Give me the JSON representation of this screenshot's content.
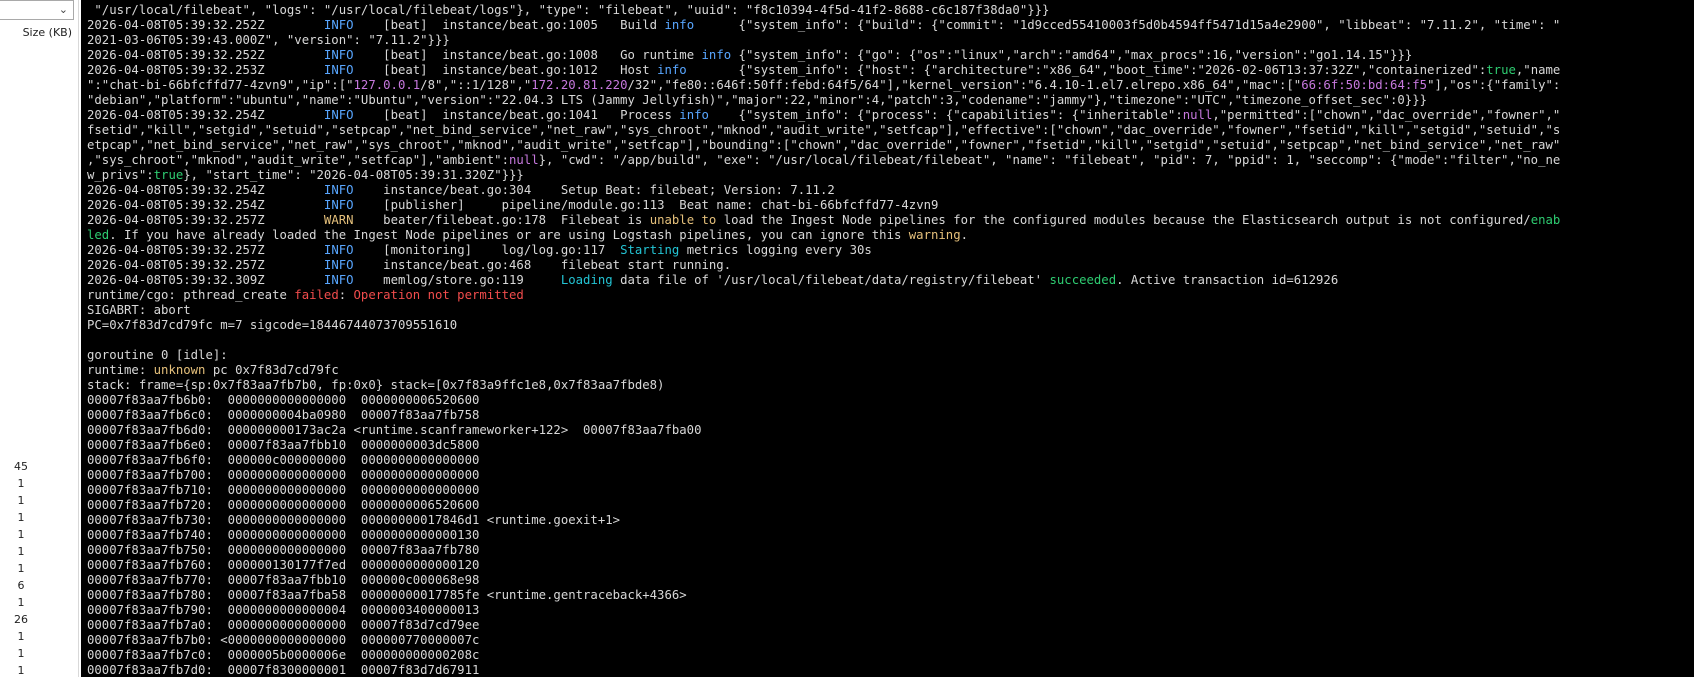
{
  "left_panel": {
    "dropdown_value": "",
    "column_header": "Size (KB)",
    "sizes": [
      "45",
      "1",
      "1",
      "1",
      "1",
      "1",
      "1",
      "6",
      "1",
      "26",
      "1",
      "1",
      "1"
    ]
  },
  "colors": {
    "info": "#58a6ff",
    "warn": "#e5c07b",
    "error": "#f14c4c",
    "null": "#c678dd",
    "success": "#2ecc71",
    "starting": "#23c4d4"
  },
  "log_lines": [
    [
      {
        "t": " \"/usr/local/filebeat\", \"logs\": \"/usr/local/filebeat/logs\"}, \"type\": \"filebeat\", \"uuid\": \"f8c10394-4f5d-41f2-8688-c6c187f38da0\"}}}"
      }
    ],
    [
      {
        "t": "2026-04-08T05:39:32.252Z        "
      },
      {
        "t": "INFO",
        "c": "i"
      },
      {
        "t": "    [beat]  instance/beat.go:1005   Build "
      },
      {
        "t": "info",
        "c": "i"
      },
      {
        "t": "      {\"system_info\": {\"build\": {\"commit\": \"1d9cced55410003f5d0b4594ff5471d15a4e2900\", \"libbeat\": \"7.11.2\", \"time\": \""
      }
    ],
    [
      {
        "t": "2021-03-06T05:39:43.000Z\", \"version\": \"7.11.2\"}}}"
      }
    ],
    [
      {
        "t": "2026-04-08T05:39:32.252Z        "
      },
      {
        "t": "INFO",
        "c": "i"
      },
      {
        "t": "    [beat]  instance/beat.go:1008   Go runtime "
      },
      {
        "t": "info",
        "c": "i"
      },
      {
        "t": " {\"system_info\": {\"go\": {\"os\":\"linux\",\"arch\":\"amd64\",\"max_procs\":16,\"version\":\"go1.14.15\"}}}"
      }
    ],
    [
      {
        "t": "2026-04-08T05:39:32.253Z        "
      },
      {
        "t": "INFO",
        "c": "i"
      },
      {
        "t": "    [beat]  instance/beat.go:1012   Host "
      },
      {
        "t": "info",
        "c": "i"
      },
      {
        "t": "       {\"system_info\": {\"host\": {\"architecture\":\"x86_64\",\"boot_time\":\"2026-02-06T13:37:32Z\",\"containerized\":"
      },
      {
        "t": "true",
        "c": "g"
      },
      {
        "t": ",\"name"
      }
    ],
    [
      {
        "t": "\":\"chat-bi-66bfcffd77-4zvn9\",\"ip\":[\""
      },
      {
        "t": "127.0.0.1",
        "c": "m"
      },
      {
        "t": "/8\",\"::1/128\",\""
      },
      {
        "t": "172.20.81.220",
        "c": "m"
      },
      {
        "t": "/32\",\"fe80::646f:50ff:febd:64f5/64\"],\"kernel_version\":\"6.4.10-1.el7.elrepo.x86_64\",\"mac\":[\""
      },
      {
        "t": "66:6f:50:bd:64:f5",
        "c": "m"
      },
      {
        "t": "\"],\"os\":{\"family\":"
      }
    ],
    [
      {
        "t": "\"debian\",\"platform\":\"ubuntu\",\"name\":\"Ubuntu\",\"version\":\"22.04.3 LTS (Jammy Jellyfish)\",\"major\":22,\"minor\":4,\"patch\":3,\"codename\":\"jammy\"},\"timezone\":\"UTC\",\"timezone_offset_sec\":0}}}"
      }
    ],
    [
      {
        "t": "2026-04-08T05:39:32.254Z        "
      },
      {
        "t": "INFO",
        "c": "i"
      },
      {
        "t": "    [beat]  instance/beat.go:1041   Process "
      },
      {
        "t": "info",
        "c": "i"
      },
      {
        "t": "    {\"system_info\": {\"process\": {\"capabilities\": {\"inheritable\":"
      },
      {
        "t": "null",
        "c": "m"
      },
      {
        "t": ",\"permitted\":[\"chown\",\"dac_override\",\"fowner\",\""
      }
    ],
    [
      {
        "t": "fsetid\",\"kill\",\"setgid\",\"setuid\",\"setpcap\",\"net_bind_service\",\"net_raw\",\"sys_chroot\",\"mknod\",\"audit_write\",\"setfcap\"],\"effective\":[\"chown\",\"dac_override\",\"fowner\",\"fsetid\",\"kill\",\"setgid\",\"setuid\",\"s"
      }
    ],
    [
      {
        "t": "etpcap\",\"net_bind_service\",\"net_raw\",\"sys_chroot\",\"mknod\",\"audit_write\",\"setfcap\"],\"bounding\":[\"chown\",\"dac_override\",\"fowner\",\"fsetid\",\"kill\",\"setgid\",\"setuid\",\"setpcap\",\"net_bind_service\",\"net_raw\""
      }
    ],
    [
      {
        "t": ",\"sys_chroot\",\"mknod\",\"audit_write\",\"setfcap\"],\"ambient\":"
      },
      {
        "t": "null",
        "c": "m"
      },
      {
        "t": "}, \"cwd\": \"/app/build\", \"exe\": \"/usr/local/filebeat/filebeat\", \"name\": \"filebeat\", \"pid\": 7, \"ppid\": 1, \"seccomp\": {\"mode\":\"filter\",\"no_ne"
      }
    ],
    [
      {
        "t": "w_privs\":"
      },
      {
        "t": "true",
        "c": "g"
      },
      {
        "t": "}, \"start_time\": \"2026-04-08T05:39:31.320Z\"}}}"
      }
    ],
    [
      {
        "t": "2026-04-08T05:39:32.254Z        "
      },
      {
        "t": "INFO",
        "c": "i"
      },
      {
        "t": "    instance/beat.go:304    Setup Beat: filebeat; Version: 7.11.2"
      }
    ],
    [
      {
        "t": "2026-04-08T05:39:32.254Z        "
      },
      {
        "t": "INFO",
        "c": "i"
      },
      {
        "t": "    [publisher]     pipeline/module.go:113  Beat name: chat-bi-66bfcffd77-4zvn9"
      }
    ],
    [
      {
        "t": "2026-04-08T05:39:32.257Z        "
      },
      {
        "t": "WARN",
        "c": "y"
      },
      {
        "t": "    beater/filebeat.go:178  Filebeat is "
      },
      {
        "t": "unable to",
        "c": "y"
      },
      {
        "t": " load the Ingest Node pipelines for the configured modules because the Elasticsearch output is not configured/"
      },
      {
        "t": "enab",
        "c": "g"
      }
    ],
    [
      {
        "t": "led",
        "c": "g"
      },
      {
        "t": ". If you have already loaded the Ingest Node pipelines or are using Logstash pipelines, you can ignore this "
      },
      {
        "t": "warning",
        "c": "y"
      },
      {
        "t": "."
      }
    ],
    [
      {
        "t": "2026-04-08T05:39:32.257Z        "
      },
      {
        "t": "INFO",
        "c": "i"
      },
      {
        "t": "    [monitoring]    log/log.go:117  "
      },
      {
        "t": "Starting",
        "c": "c"
      },
      {
        "t": " metrics logging every 30s"
      }
    ],
    [
      {
        "t": "2026-04-08T05:39:32.257Z        "
      },
      {
        "t": "INFO",
        "c": "i"
      },
      {
        "t": "    instance/beat.go:468    filebeat start running."
      }
    ],
    [
      {
        "t": "2026-04-08T05:39:32.309Z        "
      },
      {
        "t": "INFO",
        "c": "i"
      },
      {
        "t": "    memlog/store.go:119     "
      },
      {
        "t": "Loading",
        "c": "c"
      },
      {
        "t": " data file of '/usr/local/filebeat/data/registry/filebeat' "
      },
      {
        "t": "succeeded",
        "c": "g"
      },
      {
        "t": ". Active transaction id=612926"
      }
    ],
    [
      {
        "t": "runtime/cgo: pthread_create "
      },
      {
        "t": "failed",
        "c": "r"
      },
      {
        "t": ": "
      },
      {
        "t": "Operation not permitted",
        "c": "r"
      }
    ],
    [
      {
        "t": "SIGABRT: abort"
      }
    ],
    [
      {
        "t": "PC=0x7f83d7cd79fc m=7 sigcode=18446744073709551610"
      }
    ],
    [],
    [
      {
        "t": "goroutine 0 [idle]:"
      }
    ],
    [
      {
        "t": "runtime: "
      },
      {
        "t": "unknown",
        "c": "y"
      },
      {
        "t": " pc 0x7f83d7cd79fc"
      }
    ],
    [
      {
        "t": "stack: frame={sp:0x7f83aa7fb7b0, fp:0x0} stack=[0x7f83a9ffc1e8,0x7f83aa7fbde8)"
      }
    ],
    [
      {
        "t": "00007f83aa7fb6b0:  0000000000000000  0000000006520600"
      }
    ],
    [
      {
        "t": "00007f83aa7fb6c0:  0000000004ba0980  00007f83aa7fb758"
      }
    ],
    [
      {
        "t": "00007f83aa7fb6d0:  000000000173ac2a <runtime.scanframeworker+122>  00007f83aa7fba00"
      }
    ],
    [
      {
        "t": "00007f83aa7fb6e0:  00007f83aa7fbb10  0000000003dc5800"
      }
    ],
    [
      {
        "t": "00007f83aa7fb6f0:  000000c000000000  0000000000000000"
      }
    ],
    [
      {
        "t": "00007f83aa7fb700:  0000000000000000  0000000000000000"
      }
    ],
    [
      {
        "t": "00007f83aa7fb710:  0000000000000000  0000000000000000"
      }
    ],
    [
      {
        "t": "00007f83aa7fb720:  0000000000000000  0000000006520600"
      }
    ],
    [
      {
        "t": "00007f83aa7fb730:  0000000000000000  00000000017846d1 <runtime.goexit+1>"
      }
    ],
    [
      {
        "t": "00007f83aa7fb740:  0000000000000000  0000000000000130"
      }
    ],
    [
      {
        "t": "00007f83aa7fb750:  0000000000000000  00007f83aa7fb780"
      }
    ],
    [
      {
        "t": "00007f83aa7fb760:  000000130177f7ed  0000000000000120"
      }
    ],
    [
      {
        "t": "00007f83aa7fb770:  00007f83aa7fbb10  000000c000068e98"
      }
    ],
    [
      {
        "t": "00007f83aa7fb780:  00007f83aa7fba58  00000000017785fe <runtime.gentraceback+4366>"
      }
    ],
    [
      {
        "t": "00007f83aa7fb790:  0000000000000004  0000003400000013"
      }
    ],
    [
      {
        "t": "00007f83aa7fb7a0:  0000000000000000  00007f83d7cd79ee"
      }
    ],
    [
      {
        "t": "00007f83aa7fb7b0: <0000000000000000  000000770000007c"
      }
    ],
    [
      {
        "t": "00007f83aa7fb7c0:  0000005b0000006e  000000000000208c"
      }
    ],
    [
      {
        "t": "00007f83aa7fb7d0:  00007f8300000001  00007f83d7d67911"
      }
    ]
  ]
}
